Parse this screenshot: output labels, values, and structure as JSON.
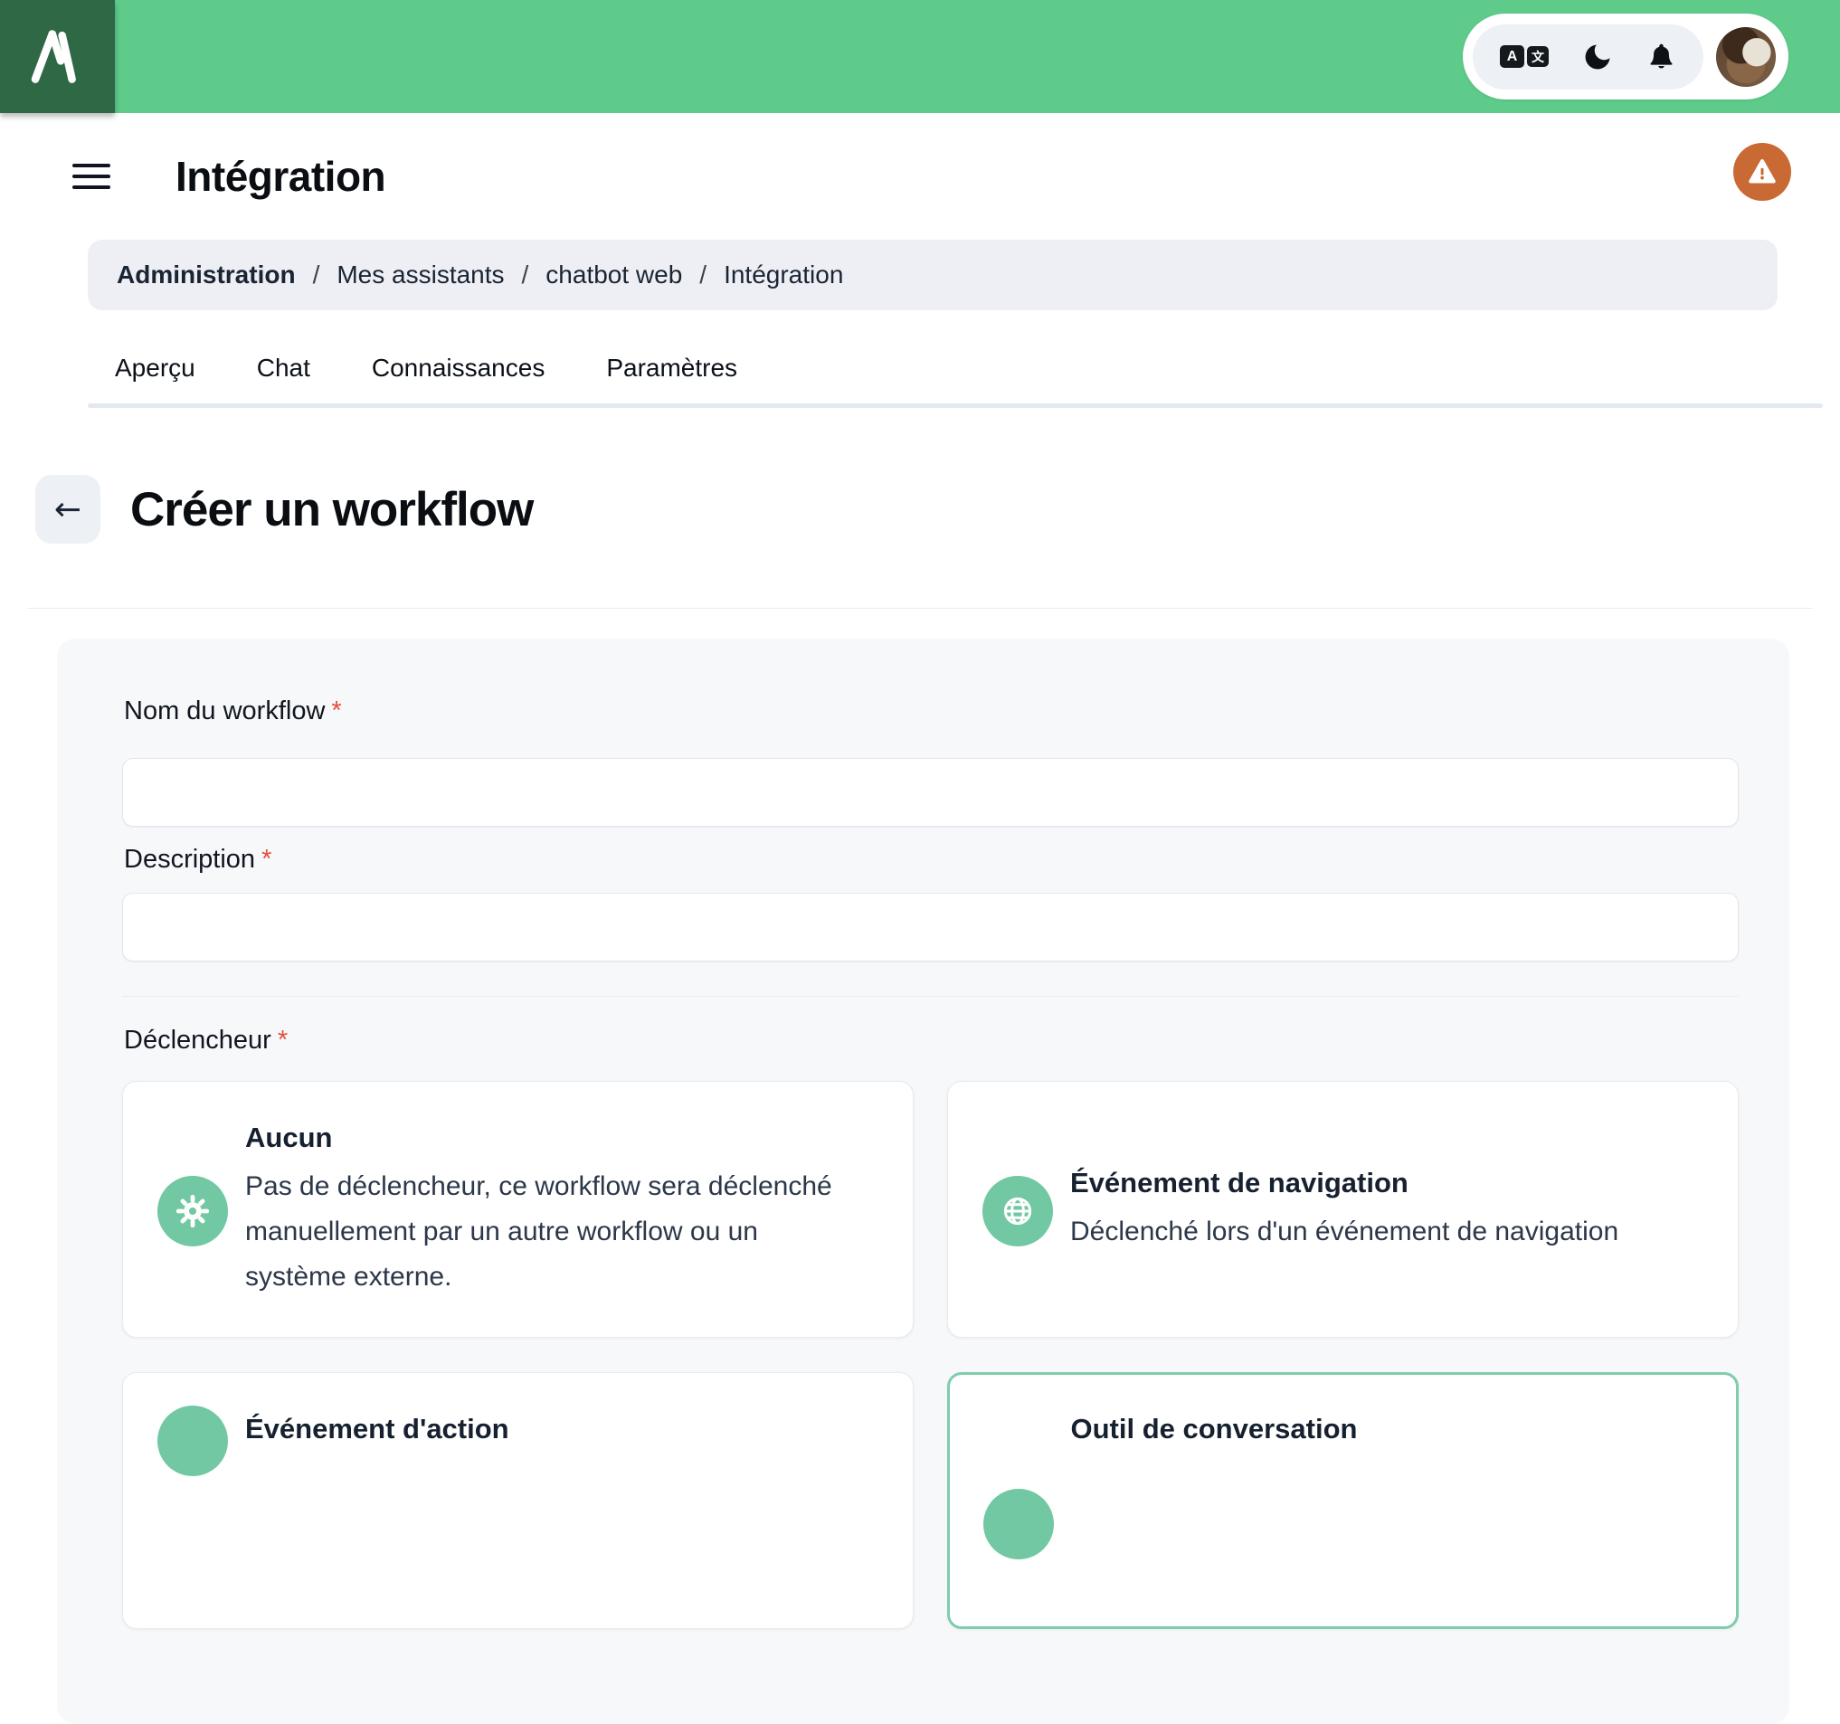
{
  "header": {
    "translate_a": "A",
    "translate_zi": "文"
  },
  "title_bar": {
    "title": "Intégration"
  },
  "breadcrumb": {
    "separator": "/",
    "items": [
      "Administration",
      "Mes assistants",
      "chatbot web",
      "Intégration"
    ]
  },
  "tabs": [
    {
      "label": "Aperçu"
    },
    {
      "label": "Chat"
    },
    {
      "label": "Connaissances"
    },
    {
      "label": "Paramètres"
    }
  ],
  "page": {
    "back_arrow": "←",
    "heading": "Créer un workflow"
  },
  "form": {
    "name_label": "Nom du workflow",
    "description_label": "Description",
    "trigger_label": "Déclencheur",
    "required_mark": "*",
    "name_value": "",
    "description_value": "",
    "trigger_options": [
      {
        "title": "Aucun",
        "description": "Pas de déclencheur, ce workflow sera déclenché manuellement par un autre workflow ou un système externe.",
        "icon": "gear-icon",
        "selected": false
      },
      {
        "title": "Événement de navigation",
        "description": "Déclenché lors d'un événement de navigation",
        "icon": "globe-icon",
        "selected": false
      },
      {
        "title": "Événement d'action",
        "icon": "circle-icon",
        "selected": false
      },
      {
        "title": "Outil de conversation",
        "icon": "circle-icon",
        "selected": true
      }
    ]
  },
  "colors": {
    "header_green": "#5ecb8b",
    "logo_dark_green": "#2f6845",
    "icon_teal": "#71c8a2",
    "warning_orange": "#c96a35",
    "required_red": "#e0503c",
    "selected_border": "#7fcdaa",
    "breadcrumb_bg": "#edeff4",
    "card_bg": "#f7f8fa"
  }
}
